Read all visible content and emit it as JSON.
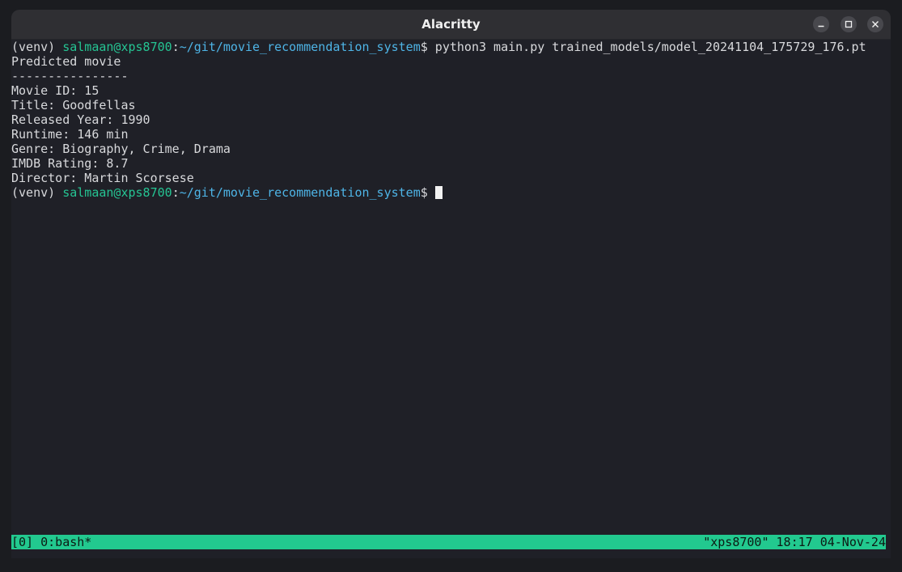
{
  "window": {
    "title": "Alacritty",
    "controls": {
      "minimize": "minimize-icon",
      "maximize": "maximize-icon",
      "close": "close-icon"
    }
  },
  "terminal": {
    "prompt1": {
      "venv": "(venv) ",
      "user_host": "salmaan@xps8700",
      "colon": ":",
      "path": "~/git/movie_recommendation_system",
      "dollar": "$ ",
      "command": "python3 main.py trained_models/model_20241104_175729_176.pt"
    },
    "output": [
      "Predicted movie",
      "----------------",
      "Movie ID: 15",
      "Title: Goodfellas",
      "Released Year: 1990",
      "Runtime: 146 min",
      "Genre: Biography, Crime, Drama",
      "IMDB Rating: 8.7",
      "Director: Martin Scorsese"
    ],
    "prompt2": {
      "venv": "(venv) ",
      "user_host": "salmaan@xps8700",
      "colon": ":",
      "path": "~/git/movie_recommendation_system",
      "dollar": "$ "
    }
  },
  "tmux_status": {
    "left": "[0] 0:bash*",
    "right": "\"xps8700\" 18:17 04-Nov-24"
  },
  "colors": {
    "prompt_user": "#25c493",
    "prompt_path": "#4eb4e6",
    "status_bar": "#22c98f",
    "background": "#1f2027"
  }
}
